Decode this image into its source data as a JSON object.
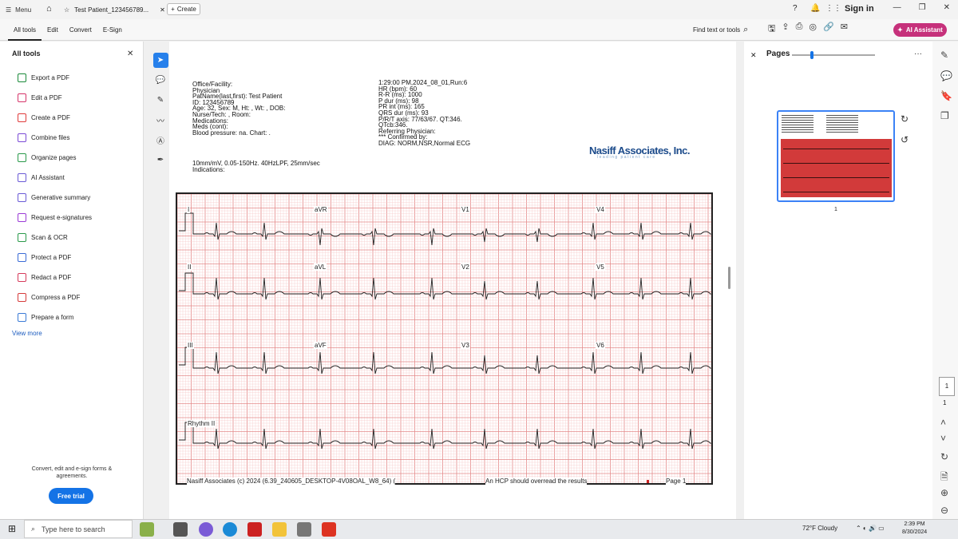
{
  "titlebar": {
    "menu_label": "Menu",
    "tab_title": "Test Patient_123456789...",
    "create_label": "Create",
    "sign_in": "Sign in"
  },
  "toolbar": {
    "tabs": [
      "All tools",
      "Edit",
      "Convert",
      "E-Sign"
    ],
    "find_text": "Find text or tools",
    "ai_assistant": "AI Assistant"
  },
  "sidebar": {
    "title": "All tools",
    "items": [
      {
        "label": "Export a PDF",
        "color": "#1b8a3a"
      },
      {
        "label": "Edit a PDF",
        "color": "#d6356a"
      },
      {
        "label": "Create a PDF",
        "color": "#e03b3b"
      },
      {
        "label": "Combine files",
        "color": "#7b4bd6"
      },
      {
        "label": "Organize pages",
        "color": "#2a9a4a"
      },
      {
        "label": "AI Assistant",
        "color": "#6b5bd6"
      },
      {
        "label": "Generative summary",
        "color": "#6b5bd6"
      },
      {
        "label": "Request e-signatures",
        "color": "#9b3bd6"
      },
      {
        "label": "Scan & OCR",
        "color": "#2a9a4a"
      },
      {
        "label": "Protect a PDF",
        "color": "#3b6bd6"
      },
      {
        "label": "Redact a PDF",
        "color": "#d63b5b"
      },
      {
        "label": "Compress a PDF",
        "color": "#d63b3b"
      },
      {
        "label": "Prepare a form",
        "color": "#3b7bd6"
      }
    ],
    "view_more": "View more",
    "promo": "Convert, edit and e-sign forms & agreements.",
    "trial": "Free trial"
  },
  "document": {
    "left_header": [
      "Office/Facility:",
      "Physician",
      "PatName(last,first): Test Patient",
      "ID: 123456789",
      "Age: 32, Sex: M, Ht: , Wt: , DOB:",
      "Nurse/Tech: , Room:",
      "Medications:",
      "Meds (cont):",
      "Blood pressure: na.   Chart: ."
    ],
    "filter_line": "10mm/mV, 0.05-150Hz. 40HzLPF, 25mm/sec",
    "indications": "Indications:",
    "right_header": [
      "1:29:00 PM,2024_08_01,Run:6",
      "HR (bpm):  60",
      "R-R (ms):  1000",
      "P dur (ms):  98",
      "PR int (ms):  165",
      "QRS dur (ms):  93",
      "P/R/T axis:  77/63/67.     QT:346.",
      "QTcb:346.",
      "Referring Physician:",
      "*** Confirmed by:",
      "DIAG: NORM,NSR,Normal ECG"
    ],
    "logo": "Nasiff Associates, Inc.",
    "logo_sub": "leading patient care",
    "leads_row1": [
      "I",
      "aVR",
      "V1",
      "V4"
    ],
    "leads_row2": [
      "II",
      "aVL",
      "V2",
      "V5"
    ],
    "leads_row3": [
      "III",
      "aVF",
      "V3",
      "V6"
    ],
    "rhythm": "Rhythm II",
    "footer_left": "Nasiff Associates (c) 2024 (6.39_240605_DESKTOP-4V08OAL_W8_64) (",
    "footer_mid": "An HCP should overread the results",
    "footer_right": "Page 1"
  },
  "pages_panel": {
    "title": "Pages",
    "page_number": "1",
    "current_page": "1",
    "total_pages": "1"
  },
  "taskbar": {
    "search_placeholder": "Type here to search",
    "weather": "72°F  Cloudy",
    "time": "2:39 PM",
    "date": "8/30/2024"
  }
}
